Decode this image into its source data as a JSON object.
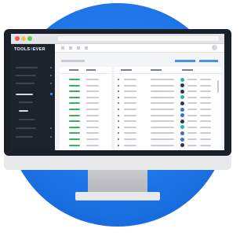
{
  "logo": {
    "text_before": "TOOLS",
    "symbol": "4",
    "text_after": "EVER"
  },
  "colors": {
    "background_circle": "#1d74e6",
    "sidebar": "#1d232d",
    "accent_green": "#3bb55b",
    "accent_blue": "#4a90e2",
    "window_close": "#ee5a52",
    "window_minimize": "#f5bf4f",
    "window_maximize": "#5fc84b"
  },
  "icons": [
    "monitor",
    "window-controls",
    "avatar",
    "status-dot"
  ],
  "status_dot_colors": [
    "#2bb5a4",
    "#1f3a4f",
    "#1f3a4f",
    "#2bb5a4",
    "#1f3a4f",
    "#3a6fd8",
    "#3a6fd8",
    "#1f3a4f",
    "#2bb5a4",
    "#3a6fd8",
    "#3a6fd8",
    "#1f3a4f"
  ]
}
